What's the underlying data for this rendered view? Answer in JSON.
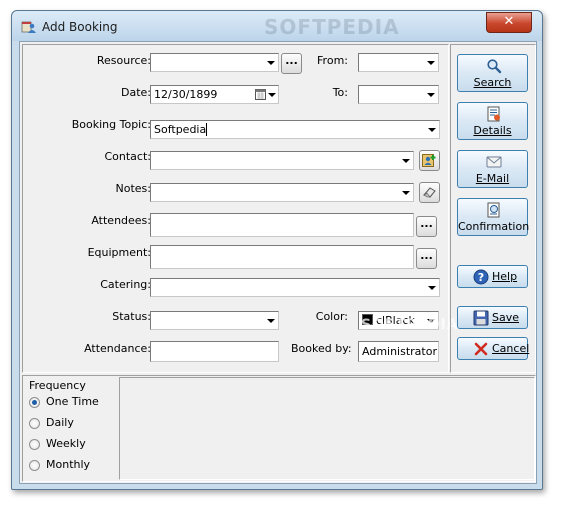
{
  "window": {
    "title": "Add Booking"
  },
  "watermark": "SOFTPEDIA",
  "form": {
    "resource_label": "Resource:",
    "resource_value": "",
    "from_label": "From:",
    "from_value": "",
    "date_label": "Date:",
    "date_value": "12/30/1899",
    "to_label": "To:",
    "to_value": "",
    "booking_topic_label": "Booking Topic:",
    "booking_topic_value": "Softpedia",
    "contact_label": "Contact:",
    "contact_value": "",
    "notes_label": "Notes:",
    "notes_value": "",
    "attendees_label": "Attendees:",
    "attendees_value": "",
    "equipment_label": "Equipment:",
    "equipment_value": "",
    "catering_label": "Catering:",
    "catering_value": "",
    "status_label": "Status:",
    "status_value": "",
    "color_label": "Color:",
    "color_value": "clBlack",
    "color_swatch": "#000000",
    "attendance_label": "Attendance:",
    "attendance_value": "",
    "booked_by_label": "Booked by:",
    "booked_by_value": "Administrator",
    "ellipsis": "..."
  },
  "buttons": {
    "search": "Search",
    "details": "Details",
    "email": "E-Mail",
    "confirmation": "Confirmation",
    "help": "Help",
    "save": "Save",
    "cancel": "Cancel"
  },
  "frequency": {
    "title": "Frequency",
    "options": [
      "One Time",
      "Daily",
      "Weekly",
      "Monthly"
    ],
    "selected": "One Time"
  },
  "colors": {
    "accent": "#3c7fb1",
    "window_frame": "#c9dcec"
  }
}
